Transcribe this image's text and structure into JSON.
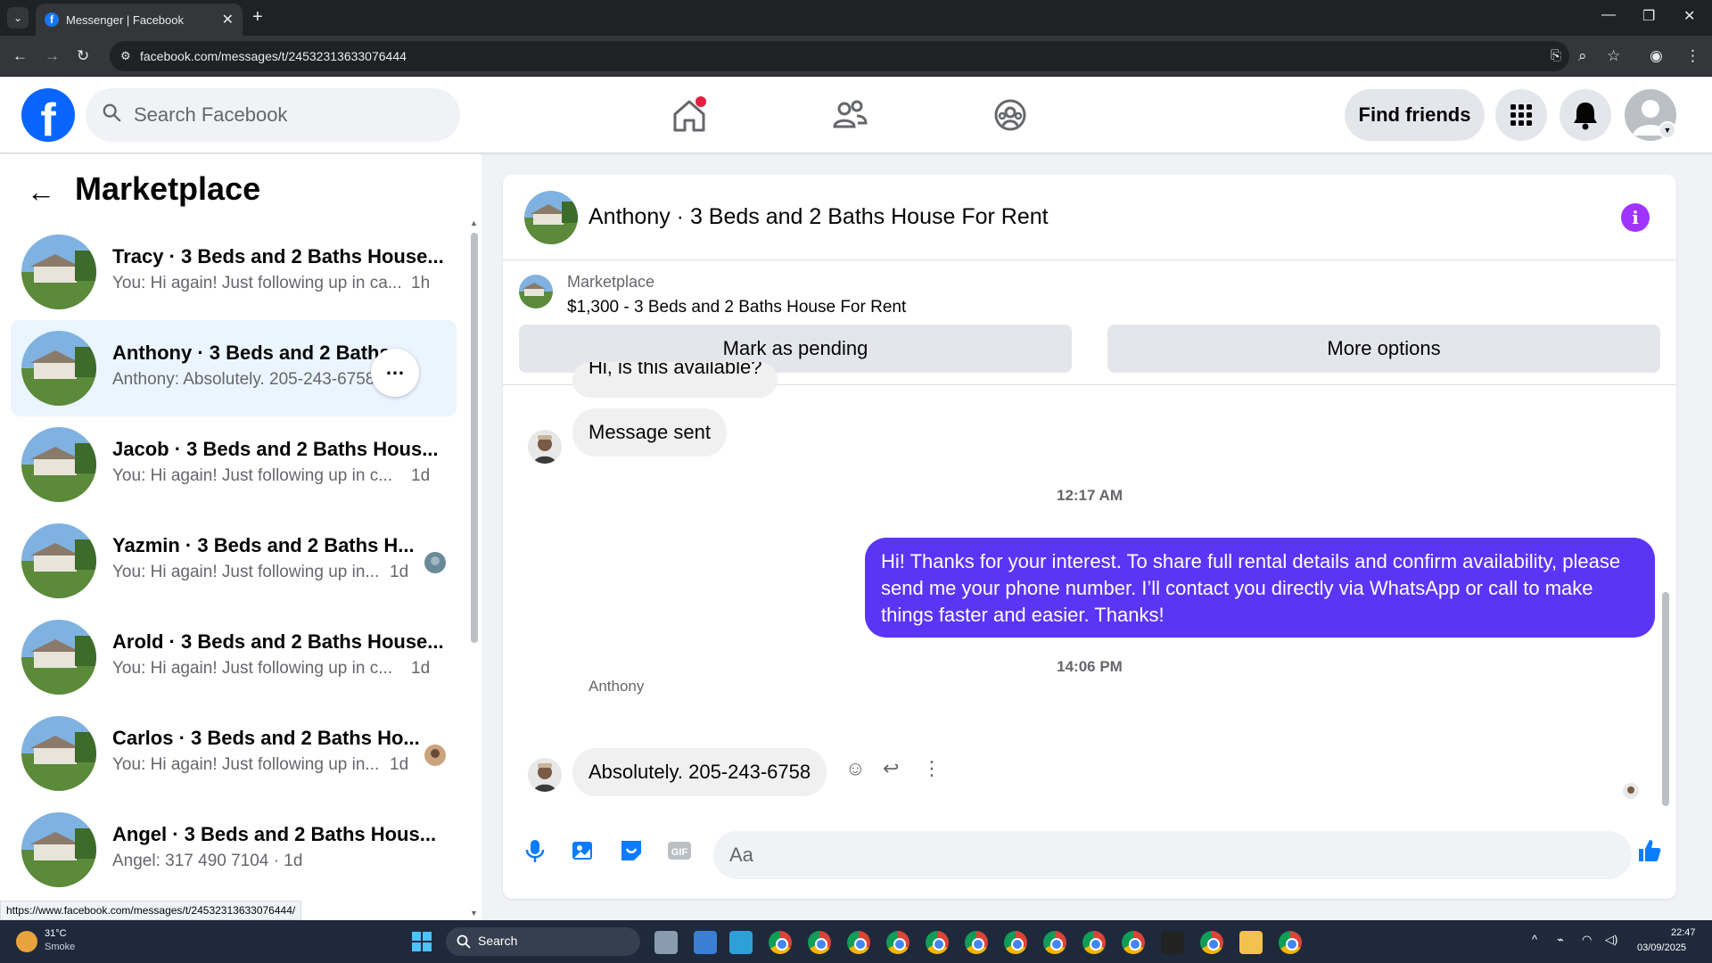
{
  "browser": {
    "tab_title": "Messenger | Facebook",
    "url": "facebook.com/messages/t/24532313633076444",
    "status_url": "https://www.facebook.com/messages/t/24532313633076444/"
  },
  "header": {
    "search_placeholder": "Search Facebook",
    "find_friends": "Find friends",
    "icons": [
      "home-icon",
      "friends-icon",
      "groups-icon",
      "menu-grid-icon",
      "bell-icon",
      "profile-avatar"
    ]
  },
  "sidebar": {
    "title": "Marketplace",
    "conversations": [
      {
        "name": "Tracy · 3 Beds and 2 Baths House...",
        "snippet": "You: Hi again! Just following up in ca...",
        "time": "1h"
      },
      {
        "name": "Anthony · 3 Beds and 2 Baths ...",
        "snippet": "Anthony: Absolutely. 205-243-6758",
        "time": ""
      },
      {
        "name": "Jacob · 3 Beds and 2 Baths Hous...",
        "snippet": "You: Hi again! Just following up in c...",
        "time": "1d"
      },
      {
        "name": "Yazmin · 3 Beds and 2 Baths H...",
        "snippet": "You: Hi again! Just following up in...",
        "time": "1d"
      },
      {
        "name": "Arold · 3 Beds and 2 Baths House...",
        "snippet": "You: Hi again! Just following up in c...",
        "time": "1d"
      },
      {
        "name": "Carlos · 3 Beds and 2 Baths Ho...",
        "snippet": "You: Hi again! Just following up in...",
        "time": "1d"
      },
      {
        "name": "Angel · 3 Beds and 2 Baths Hous...",
        "snippet": "Angel: 317 490 7104 · 1d",
        "time": ""
      }
    ]
  },
  "chat": {
    "title": "Anthony · 3 Beds and 2 Baths House For Rent",
    "marketplace_label": "Marketplace",
    "listing": "$1,300 - 3 Beds and 2 Baths House For Rent",
    "mark_pending": "Mark as pending",
    "more_options": "More options",
    "partial_msg": "Hi, is this available?",
    "msg_sent": "Message sent",
    "ts1": "12:17 AM",
    "outgoing": "Hi! Thanks for your interest. To share full rental details and confirm availability, please send me your phone number. I’ll contact you directly via WhatsApp or call to make things faster and easier. Thanks!",
    "ts2": "14:06 PM",
    "sender": "Anthony",
    "reply": "Absolutely. 205-243-6758",
    "composer_placeholder": "Aa"
  },
  "taskbar": {
    "temp": "31°C",
    "condition": "Smoke",
    "search": "Search",
    "time": "22:47",
    "date": "03/09/2025"
  },
  "colors": {
    "fb_blue": "#0866ff",
    "outgoing_bubble": "#5b35f5",
    "info": "#a033ff",
    "active_conv": "#ebf5ff"
  }
}
